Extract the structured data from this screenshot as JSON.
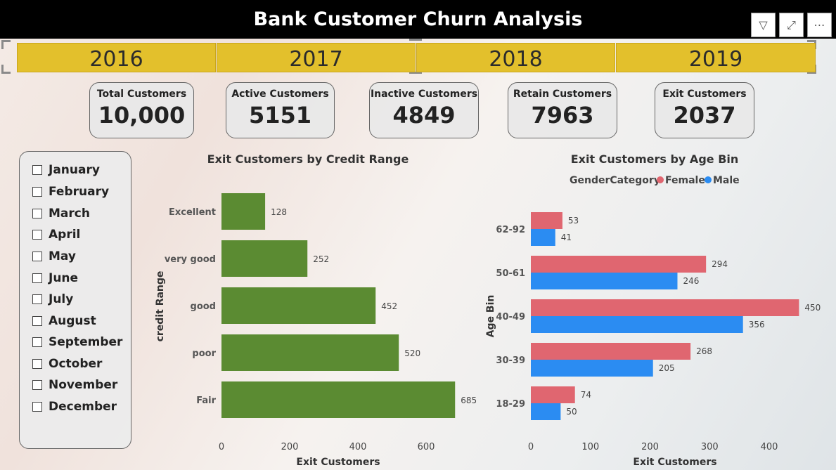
{
  "header": {
    "title": "Bank Customer Churn Analysis",
    "tools": [
      {
        "name": "filter-icon",
        "glyph": "▽"
      },
      {
        "name": "focus-mode-icon",
        "glyph": "⤢"
      },
      {
        "name": "more-options-icon",
        "glyph": "⋯"
      }
    ]
  },
  "years": [
    "2016",
    "2017",
    "2018",
    "2019"
  ],
  "kpis": [
    {
      "label": "Total Customers",
      "value": "10,000"
    },
    {
      "label": "Active Customers",
      "value": "5151"
    },
    {
      "label": "Inactive Customers",
      "value": "4849"
    },
    {
      "label": "Retain Customers",
      "value": "7963"
    },
    {
      "label": "Exit Customers",
      "value": "2037"
    }
  ],
  "months": [
    "January",
    "February",
    "March",
    "April",
    "May",
    "June",
    "July",
    "August",
    "September",
    "October",
    "November",
    "December"
  ],
  "colors": {
    "credit_bar": "#5b8b32",
    "female": "#e06670",
    "male": "#2b8cf2",
    "year_tile": "#e3c02c"
  },
  "chart_data": [
    {
      "type": "bar",
      "orientation": "horizontal",
      "title": "Exit Customers by Credit Range",
      "xlabel": "Exit Customers",
      "ylabel": "credit Range",
      "categories": [
        "Excellent",
        "very good",
        "good",
        "poor",
        "Fair"
      ],
      "values": [
        128,
        252,
        452,
        520,
        685
      ],
      "xlim": [
        0,
        700
      ],
      "xticks": [
        0,
        200,
        400,
        600
      ]
    },
    {
      "type": "bar",
      "orientation": "horizontal",
      "title": "Exit Customers by Age Bin",
      "xlabel": "Exit Customers",
      "ylabel": "Age Bin",
      "legend_title": "GenderCategory",
      "legend_position": "top",
      "categories": [
        "62-92",
        "50-61",
        "40-49",
        "30-39",
        "18-29"
      ],
      "series": [
        {
          "name": "Female",
          "values": [
            53,
            294,
            450,
            268,
            74
          ]
        },
        {
          "name": "Male",
          "values": [
            41,
            246,
            356,
            205,
            50
          ]
        }
      ],
      "xlim": [
        0,
        460
      ],
      "xticks": [
        0,
        100,
        200,
        300,
        400
      ]
    }
  ]
}
